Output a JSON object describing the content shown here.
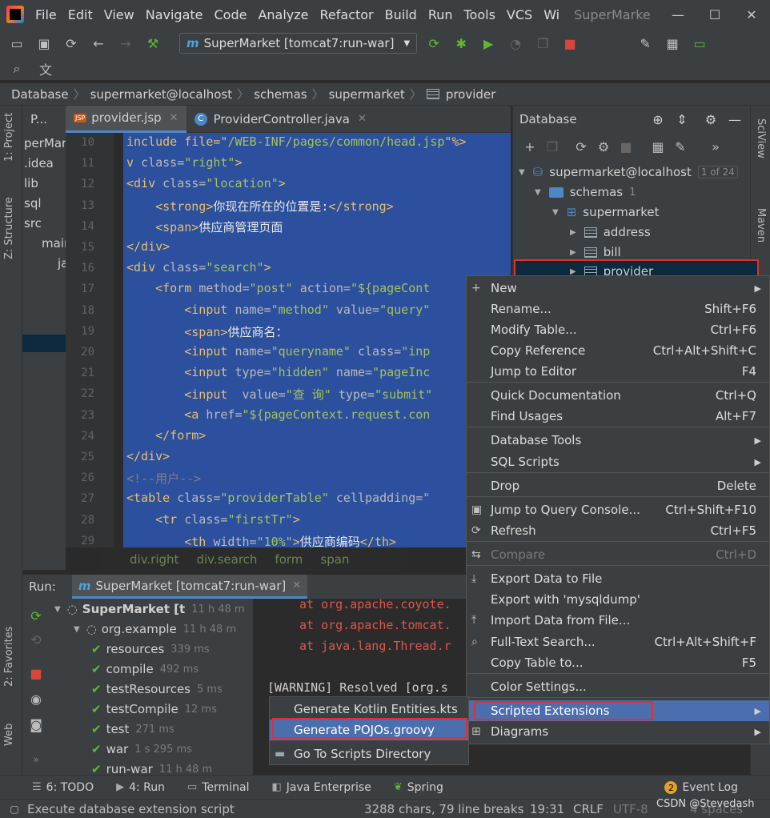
{
  "menubar": {
    "items": [
      "File",
      "Edit",
      "View",
      "Navigate",
      "Code",
      "Analyze",
      "Refactor",
      "Build",
      "Run",
      "Tools",
      "VCS",
      "Wi"
    ],
    "window_title": "SuperMarke"
  },
  "toolbar": {
    "run_config": "SuperMarket [tomcat7:run-war]"
  },
  "breadcrumb": [
    "Database",
    "supermarket@localhost",
    "schemas",
    "supermarket",
    "provider"
  ],
  "left_strip": {
    "project": "1: Project",
    "structure": "Z: Structure",
    "favorites": "2: Favorites",
    "web": "Web"
  },
  "right_strip": {
    "sciview": "SciView",
    "maven": "Maven"
  },
  "project_panel": {
    "tab": "P...",
    "items": [
      "perMar",
      ".idea",
      "lib",
      "sql",
      "src",
      "main",
      "ja"
    ]
  },
  "editor_tabs": [
    {
      "label": "provider.jsp",
      "active": true
    },
    {
      "label": "ProviderController.java",
      "active": false
    }
  ],
  "editor": {
    "lines": [
      {
        "n": "10",
        "html": "include file=\"<span class='v'>/WEB-INF/pages/common/head.jsp</span>\"%>"
      },
      {
        "n": "11",
        "html": "v <span class='a'>class=</span><span class='v'>\"right\"</span>>"
      },
      {
        "n": "12",
        "html": "<div <span class='a'>class=</span><span class='v'>\"location\"</span>>"
      },
      {
        "n": "13",
        "html": "    <strong><span class='t'>你现在所在的位置是:</span></strong>"
      },
      {
        "n": "14",
        "html": "    <span><span class='t'>供应商管理页面</span></span>"
      },
      {
        "n": "15",
        "html": "</div>"
      },
      {
        "n": "16",
        "html": "<div <span class='a'>class=</span><span class='v'>\"search\"</span>>"
      },
      {
        "n": "17",
        "html": "    <form <span class='a'>method=</span><span class='v'>\"post\"</span> <span class='a'>action=</span><span class='v'>\"${pageCont</span>"
      },
      {
        "n": "18",
        "html": "        <input <span class='a'>name=</span><span class='v'>\"method\"</span> <span class='a'>value=</span><span class='v'>\"query\"</span>"
      },
      {
        "n": "19",
        "html": "        <span><span class='t'>供应商名：</span></span>"
      },
      {
        "n": "20",
        "html": "        <input <span class='a'>name=</span><span class='v'>\"queryname\"</span> <span class='a'>class=</span><span class='v'>\"inp</span>"
      },
      {
        "n": "21",
        "html": "        <input <span class='a'>type=</span><span class='v'>\"hidden\"</span> <span class='a'>name=</span><span class='v'>\"pageInc</span>"
      },
      {
        "n": "22",
        "html": "        <input  <span class='a'>value=</span><span class='v'>\"查 询\"</span> <span class='a'>type=</span><span class='v'>\"submit\"</span>"
      },
      {
        "n": "23",
        "html": "        <a <span class='a'>href=</span><span class='v'>\"${pageContext.request.con</span>"
      },
      {
        "n": "24",
        "html": "    </form>"
      },
      {
        "n": "25",
        "html": "</div>"
      },
      {
        "n": "26",
        "html": "<span class='c'><!--用户--></span>"
      },
      {
        "n": "27",
        "html": "<table <span class='a'>class=</span><span class='v'>\"providerTable\"</span> <span class='a'>cellpadding=</span><span class='v'>\"</span>"
      },
      {
        "n": "28",
        "html": "    <tr <span class='a'>class=</span><span class='v'>\"firstTr\"</span>>"
      },
      {
        "n": "29",
        "html": "        <th <span class='a'>width=</span><span class='v'>\"10%\"</span>><span class='t'>供应商编码</span></th>"
      }
    ],
    "crumbs": [
      "div.right",
      "div.search",
      "form",
      "span"
    ]
  },
  "db_panel": {
    "title": "Database",
    "tree": {
      "datasource": "supermarket@localhost",
      "count_badge": "1 of 24",
      "schemas": "schemas",
      "schemas_count": "1",
      "schema": "supermarket",
      "tables": [
        "address",
        "bill",
        "provider"
      ]
    }
  },
  "context_menu": {
    "items": [
      {
        "label": "New",
        "shortcut": "",
        "submenu": true,
        "icon": "+"
      },
      {
        "label": "Rename...",
        "shortcut": "Shift+F6"
      },
      {
        "label": "Modify Table...",
        "shortcut": "Ctrl+F6"
      },
      {
        "label": "Copy Reference",
        "shortcut": "Ctrl+Alt+Shift+C"
      },
      {
        "label": "Jump to Editor",
        "shortcut": "F4"
      },
      {
        "label": "Quick Documentation",
        "shortcut": "Ctrl+Q"
      },
      {
        "label": "Find Usages",
        "shortcut": "Alt+F7"
      },
      {
        "label": "Database Tools",
        "shortcut": "",
        "submenu": true
      },
      {
        "label": "SQL Scripts",
        "shortcut": "",
        "submenu": true
      },
      {
        "label": "Drop",
        "shortcut": "Delete"
      },
      {
        "label": "Jump to Query Console...",
        "shortcut": "Ctrl+Shift+F10",
        "icon": "▣"
      },
      {
        "label": "Refresh",
        "shortcut": "Ctrl+F5",
        "icon": "⟳"
      },
      {
        "label": "Compare",
        "shortcut": "Ctrl+D",
        "disabled": true,
        "icon": "⇆"
      },
      {
        "label": "Export Data to File",
        "shortcut": "",
        "icon": "⤓"
      },
      {
        "label": "Export with 'mysqldump'",
        "shortcut": ""
      },
      {
        "label": "Import Data from File...",
        "shortcut": "",
        "icon": "⤒"
      },
      {
        "label": "Full-Text Search...",
        "shortcut": "Ctrl+Alt+Shift+F",
        "icon": "⌕"
      },
      {
        "label": "Copy Table to...",
        "shortcut": "F5"
      },
      {
        "label": "Color Settings...",
        "shortcut": ""
      },
      {
        "label": "Scripted Extensions",
        "shortcut": "",
        "submenu": true,
        "highlighted": true
      },
      {
        "label": "Diagrams",
        "shortcut": "",
        "submenu": true,
        "icon": "⊞"
      }
    ]
  },
  "submenu": {
    "items": [
      {
        "label": "Generate Kotlin Entities.kts"
      },
      {
        "label": "Generate POJOs.groovy",
        "highlighted": true
      },
      {
        "label": "Go To Scripts Directory",
        "icon": "folder"
      }
    ]
  },
  "run_panel": {
    "label": "Run:",
    "tab": "SuperMarket [tomcat7:run-war]",
    "tree": [
      {
        "label": "SuperMarket [t",
        "time": "11 h 48 m"
      },
      {
        "label": "org.example",
        "time": "11 h 48 m"
      },
      {
        "label": "resources",
        "time": "339 ms"
      },
      {
        "label": "compile",
        "time": "492 ms"
      },
      {
        "label": "testResources",
        "time": "5 ms"
      },
      {
        "label": "testCompile",
        "time": "12 ms"
      },
      {
        "label": "test",
        "time": "271 ms"
      },
      {
        "label": "war",
        "time": "1 s 295 ms"
      },
      {
        "label": "run-war",
        "time": "11 h 48 m"
      }
    ],
    "console": [
      "at org.apache.coyote.",
      "at org.apache.tomcat.",
      "at java.lang.Thread.r",
      "[WARNING] Resolved [org.s"
    ]
  },
  "bottom_tools": [
    "6: TODO",
    "4: Run",
    "Terminal",
    "Java Enterprise",
    "Spring"
  ],
  "event_log": {
    "count": "2",
    "label": "Event Log"
  },
  "status": {
    "message": "Execute database extension script",
    "chars": "3288 chars, 79 line breaks",
    "position": "19:31",
    "line_sep": "CRLF",
    "encoding": "UTF-8",
    "indent": "4 spaces",
    "watermark": "CSDN @Stevedash"
  },
  "colors": {
    "selection_blue": "#2c54a7",
    "highlight": "#4b6eaf",
    "annotation_red": "#e03030"
  }
}
